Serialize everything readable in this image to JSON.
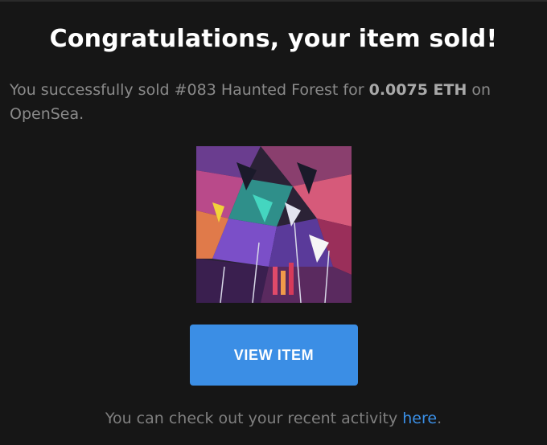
{
  "headline": "Congratulations, your item sold!",
  "message": {
    "prefix": "You successfully sold ",
    "item_name": "#083 Haunted Forest",
    "middle": " for ",
    "amount": "0.0075 ETH",
    "suffix": " on OpenSea."
  },
  "artwork": {
    "description_icon": "nft-artwork-image"
  },
  "button": {
    "label": "VIEW ITEM"
  },
  "footer": {
    "prefix": "You can check out your recent activity ",
    "link_label": "here",
    "suffix": "."
  },
  "colors": {
    "background": "#161616",
    "button": "#3b8ee5",
    "link": "#3a8fe6",
    "headline": "#ffffff",
    "body_text": "#8a8a8a"
  }
}
